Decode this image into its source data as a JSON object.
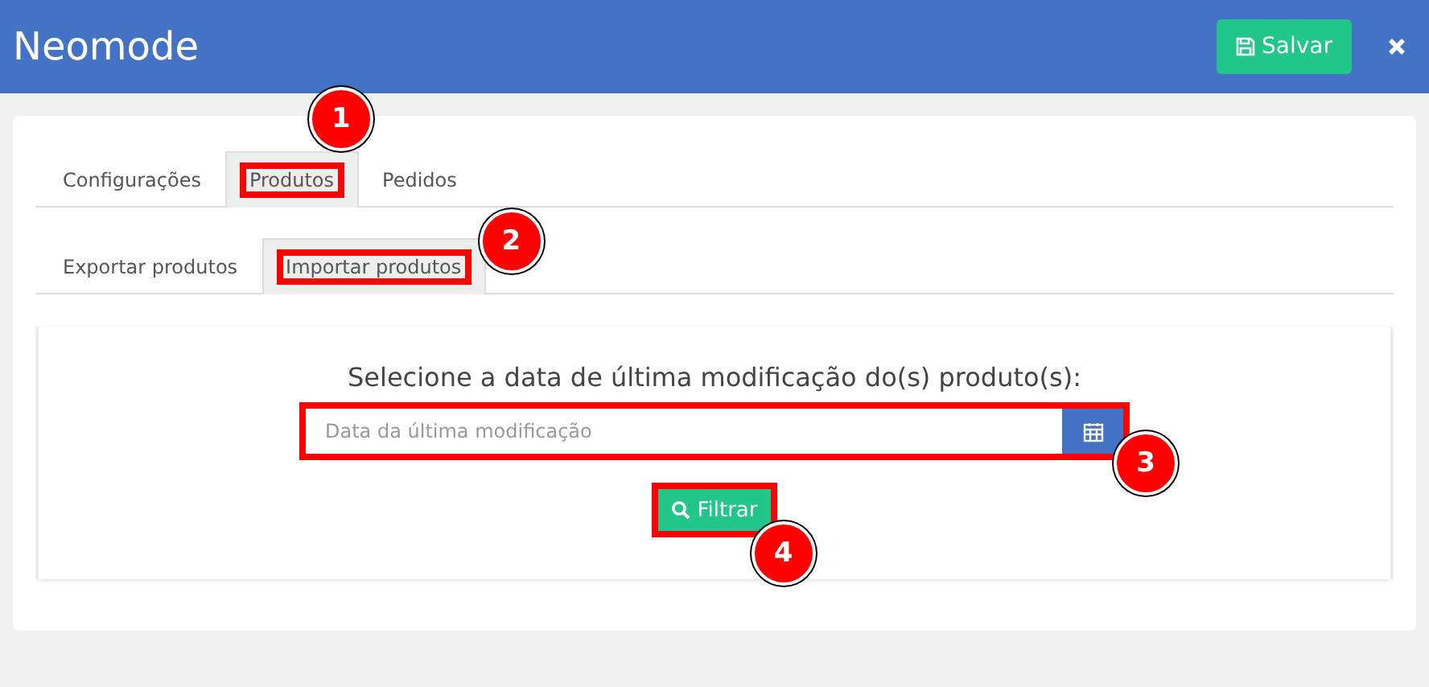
{
  "header": {
    "title": "Neomode",
    "save_button": "Salvar"
  },
  "tabs": [
    {
      "label": "Configurações",
      "selected": false,
      "highlighted": false
    },
    {
      "label": "Produtos",
      "selected": true,
      "highlighted": true,
      "callout": "1"
    },
    {
      "label": "Pedidos",
      "selected": false,
      "highlighted": false
    }
  ],
  "subtabs": [
    {
      "label": "Exportar produtos",
      "selected": false,
      "highlighted": false
    },
    {
      "label": "Importar produtos",
      "selected": true,
      "highlighted": true,
      "callout": "2"
    }
  ],
  "filter": {
    "prompt": "Selecione a data de última modificação do(s) produto(s):",
    "date_field": {
      "placeholder": "Data da última modificação",
      "highlighted": true,
      "callout": "3"
    },
    "button": {
      "label": "Filtrar",
      "highlighted": true,
      "callout": "4"
    }
  }
}
